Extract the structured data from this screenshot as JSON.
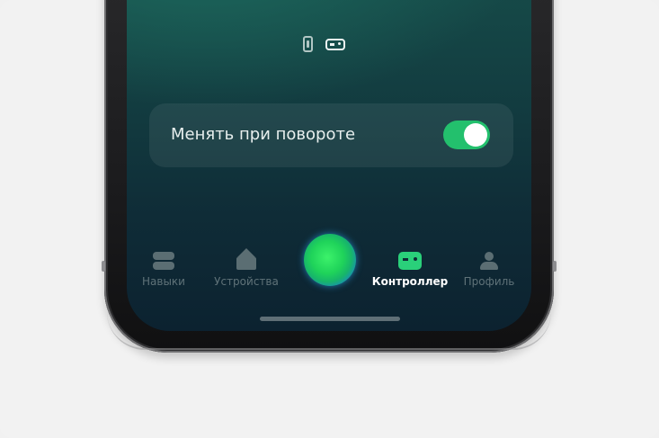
{
  "settings": {
    "rotate_toggle": {
      "label": "Менять при повороте",
      "enabled": true
    }
  },
  "mode_icons": [
    "phone-icon",
    "gamepad-icon"
  ],
  "tabbar": {
    "tabs": [
      {
        "label": "Навыки",
        "icon": "skills-icon",
        "active": false
      },
      {
        "label": "Устройства",
        "icon": "home-icon",
        "active": false
      },
      {
        "label": "Контроллер",
        "icon": "controller-icon",
        "active": true
      },
      {
        "label": "Профиль",
        "icon": "profile-icon",
        "active": false
      }
    ],
    "center_button": "assistant-orb"
  },
  "colors": {
    "accent": "#23c06d",
    "active_tab_icon": "#2ad07a",
    "screen_top": "#174f4b",
    "screen_bottom": "#0c2230"
  }
}
